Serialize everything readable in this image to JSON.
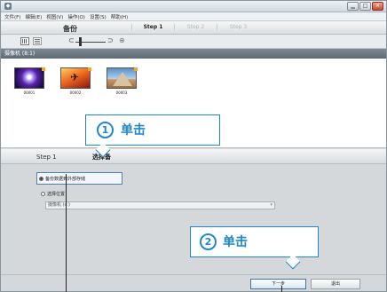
{
  "window": {
    "app_icon_glyph": "◆",
    "controls": [
      "▁",
      "□",
      "✕"
    ]
  },
  "menu": {
    "items": [
      "文件(F)",
      "编辑(E)",
      "视图(V)",
      "操作(O)",
      "设置(S)",
      "帮助(H)"
    ]
  },
  "tabstrip": {
    "mode_label": "备份",
    "steps": [
      "Step 1",
      "Step 2",
      "Step 3"
    ],
    "active_step": "Step 1"
  },
  "toolbar": {
    "view_thumbnail_icon": "grid-icon",
    "view_list_icon": "list-icon",
    "zoom_out_glyph": "⊂",
    "zoom_in_glyph": "⊃",
    "extra_glyph": "⊕"
  },
  "media": {
    "header": "摄像机 (8:1)",
    "items": [
      {
        "label": "00001"
      },
      {
        "label": "00002"
      },
      {
        "label": "00003"
      }
    ]
  },
  "callouts": {
    "c1": {
      "number": "1",
      "text": "单击"
    },
    "c2": {
      "number": "2",
      "text": "单击"
    }
  },
  "stepbar": {
    "step_label": "Step 1",
    "select_label": "选择备"
  },
  "options": {
    "opt1": "备份数据到外部存储",
    "opt2": "选择位置",
    "opt2_select_value": "摄像机 (c:)",
    "opt2_arrow": "▾"
  },
  "footer": {
    "next_label": "下一步",
    "quit_label": "退出"
  },
  "colors": {
    "callout_blue": "#1f88c9",
    "header_gray": "#6c7782",
    "window_bg": "#d7dcdf"
  }
}
